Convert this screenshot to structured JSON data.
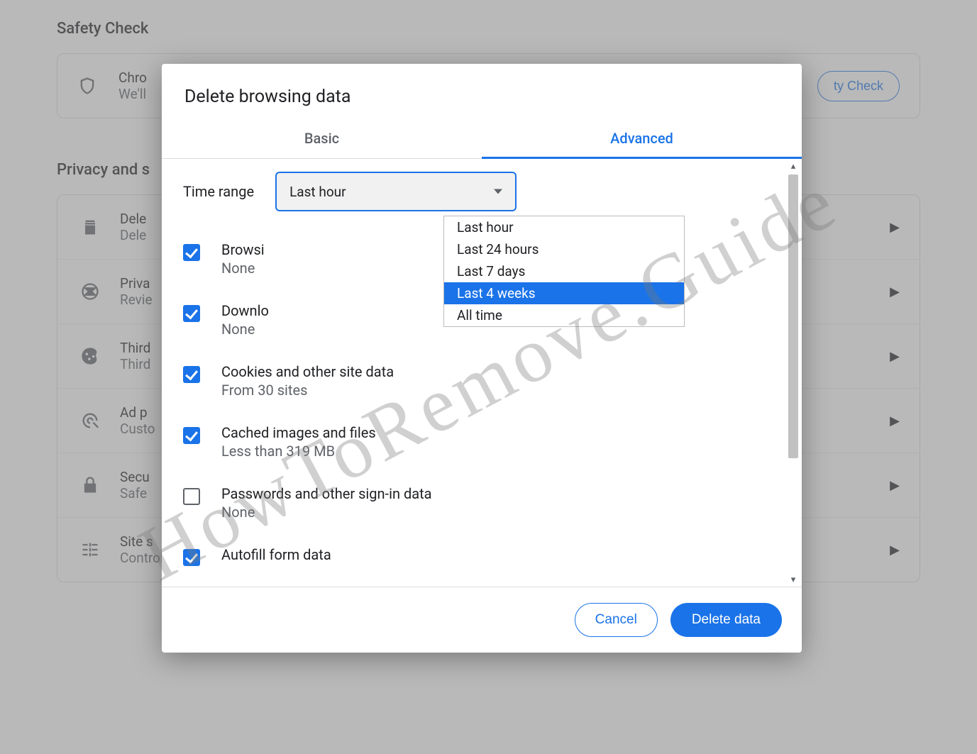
{
  "watermark_text": "HowToRemove.Guide",
  "background": {
    "safety_title": "Safety Check",
    "safety_line1": "Chro",
    "safety_line2": "We'll",
    "safety_button": "ty Check",
    "privacy_title": "Privacy and s",
    "rows": [
      {
        "title": "Dele",
        "desc": "Dele"
      },
      {
        "title": "Priva",
        "desc": "Revie"
      },
      {
        "title": "Third",
        "desc": "Third"
      },
      {
        "title": "Ad p",
        "desc": "Custo"
      },
      {
        "title": "Secu",
        "desc": "Safe"
      },
      {
        "title": "Site s",
        "desc": "Controls what information sites can use and show (location, camera, pop-ups, and more)"
      }
    ]
  },
  "dialog": {
    "title": "Delete browsing data",
    "tabs": {
      "basic": "Basic",
      "advanced": "Advanced"
    },
    "active_tab": "advanced",
    "time_range_label": "Time range",
    "time_range_selected": "Last hour",
    "time_range_options": [
      "Last hour",
      "Last 24 hours",
      "Last 7 days",
      "Last 4 weeks",
      "All time"
    ],
    "time_range_highlighted": "Last 4 weeks",
    "items": [
      {
        "title": "Browsi",
        "desc": "None",
        "checked": true
      },
      {
        "title": "Downlo",
        "desc": "None",
        "checked": true
      },
      {
        "title": "Cookies and other site data",
        "desc": "From 30 sites",
        "checked": true
      },
      {
        "title": "Cached images and files",
        "desc": "Less than 319 MB",
        "checked": true
      },
      {
        "title": "Passwords and other sign-in data",
        "desc": "None",
        "checked": false
      },
      {
        "title": "Autofill form data",
        "desc": "",
        "checked": true
      }
    ],
    "buttons": {
      "cancel": "Cancel",
      "delete": "Delete data"
    }
  }
}
